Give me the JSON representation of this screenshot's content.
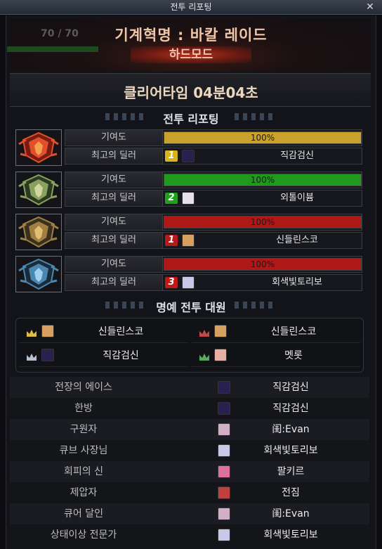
{
  "window": {
    "title": "전투 리포팅",
    "close_icon": "close-icon"
  },
  "hp_display": "70 / 70",
  "dungeon": {
    "name": "기계혁명 : 바칼 레이드",
    "mode": "하드모드"
  },
  "clear_time": "클리어타임  04분04초",
  "sections": {
    "report": "전투 리포팅",
    "honor": "명예 전투 대원"
  },
  "bosses": [
    {
      "icon": "red-boss-emblem-icon",
      "contribution_label": "기여도",
      "contribution": "100%",
      "contribution_value": 1.0,
      "bar_color": "#c8a22a",
      "best_dealer_label": "최고의 딜러",
      "rank": "1",
      "rank_color": "#d8b31a",
      "avatar_color": "#2a2050",
      "dealer": "직감검신"
    },
    {
      "icon": "green-boss-emblem-icon",
      "contribution_label": "기여도",
      "contribution": "100%",
      "contribution_value": 1.0,
      "bar_color": "#1f9a1c",
      "best_dealer_label": "최고의 딜러",
      "rank": "2",
      "rank_color": "#1fa21a",
      "avatar_color": "#e8e0e8",
      "dealer": "외톨이븀"
    },
    {
      "icon": "gold-boss-emblem-icon",
      "contribution_label": "기여도",
      "contribution": "100%",
      "contribution_value": 1.0,
      "bar_color": "#b01818",
      "best_dealer_label": "최고의 딜러",
      "rank": "1",
      "rank_color": "#b61a1a",
      "avatar_color": "#d8a060",
      "dealer": "신들린스코"
    },
    {
      "icon": "blue-boss-emblem-icon",
      "contribution_label": "기여도",
      "contribution": "100%",
      "contribution_value": 1.0,
      "bar_color": "#b01818",
      "best_dealer_label": "최고의 딜러",
      "rank": "3",
      "rank_color": "#c21818",
      "avatar_color": "#c8c8e8",
      "dealer": "회색빛토리보"
    }
  ],
  "honor_members": [
    {
      "name": "신들린스코",
      "crown": "gold-crown-icon",
      "avatar_color": "#d8a060"
    },
    {
      "name": "신들린스코",
      "crown": "red-crown-icon",
      "avatar_color": "#d8a060"
    },
    {
      "name": "직감검신",
      "crown": "silver-crown-icon",
      "avatar_color": "#2a2050"
    },
    {
      "name": "멧롯",
      "crown": "green-crown-icon",
      "avatar_color": "#e8b0a0"
    }
  ],
  "awards": [
    {
      "title": "전장의 에이스",
      "player": "직감검신",
      "avatar_color": "#2a2050"
    },
    {
      "title": "한방",
      "player": "직감검신",
      "avatar_color": "#2a2050"
    },
    {
      "title": "구원자",
      "player": "闺:Evan",
      "avatar_color": "#d0b0c8"
    },
    {
      "title": "큐브 사장님",
      "player": "회색빛토리보",
      "avatar_color": "#c8c8e8"
    },
    {
      "title": "회피의 신",
      "player": "팔키르",
      "avatar_color": "#e070a0"
    },
    {
      "title": "제압자",
      "player": "전짐",
      "avatar_color": "#c04040"
    },
    {
      "title": "큐어 달인",
      "player": "闺:Evan",
      "avatar_color": "#d0b0c8"
    },
    {
      "title": "상태이상 전문가",
      "player": "회색빛토리보",
      "avatar_color": "#c8c8e8"
    }
  ]
}
